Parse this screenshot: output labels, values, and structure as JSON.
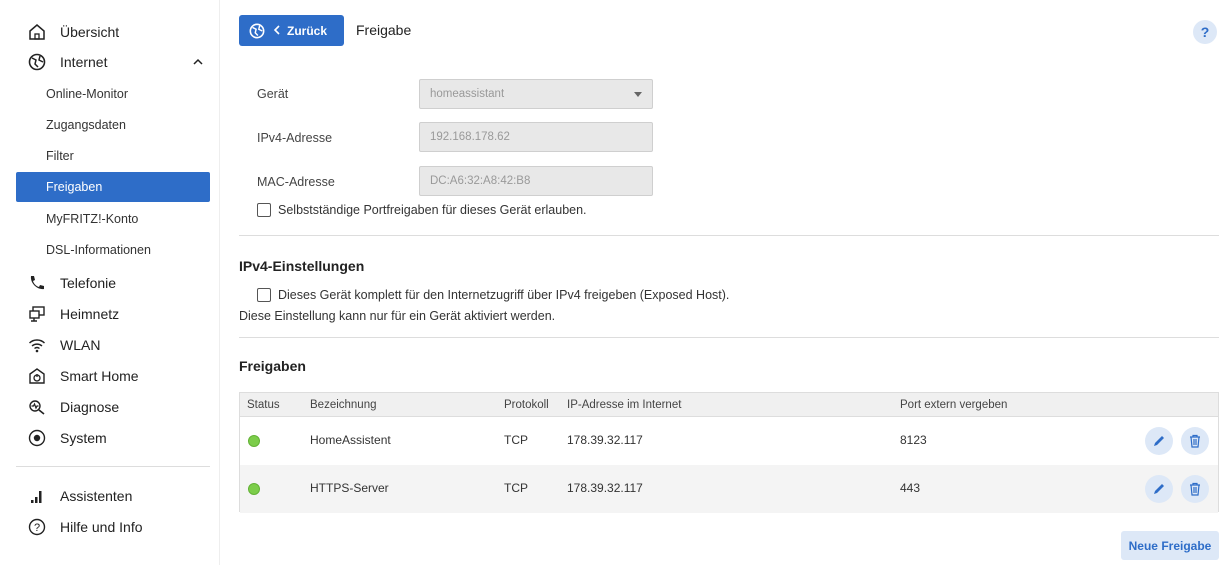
{
  "sidebar": {
    "items": [
      {
        "label": "Übersicht",
        "icon": "home-icon"
      },
      {
        "label": "Internet",
        "icon": "globe-icon"
      },
      {
        "label": "Telefonie",
        "icon": "phone-icon"
      },
      {
        "label": "Heimnetz",
        "icon": "network-icon"
      },
      {
        "label": "WLAN",
        "icon": "wifi-icon"
      },
      {
        "label": "Smart Home",
        "icon": "smarthome-icon"
      },
      {
        "label": "Diagnose",
        "icon": "diagnose-icon"
      },
      {
        "label": "System",
        "icon": "system-icon"
      }
    ],
    "sub_items": [
      {
        "label": "Online-Monitor"
      },
      {
        "label": "Zugangsdaten"
      },
      {
        "label": "Filter"
      },
      {
        "label": "Freigaben",
        "active": true
      },
      {
        "label": "MyFRITZ!-Konto"
      },
      {
        "label": "DSL-Informationen"
      }
    ],
    "bottom_items": [
      {
        "label": "Assistenten",
        "icon": "assistant-icon"
      },
      {
        "label": "Hilfe und Info",
        "icon": "help-circle-icon"
      }
    ]
  },
  "header": {
    "back_label": "Zurück",
    "title": "Freigabe",
    "help": "?"
  },
  "form": {
    "device_label": "Gerät",
    "device_value": "homeassistant",
    "ipv4_label": "IPv4-Adresse",
    "ipv4_value": "192.168.178.62",
    "mac_label": "MAC-Adresse",
    "mac_value": "DC:A6:32:A8:42:B8",
    "self_portforward_label": "Selbstständige Portfreigaben für dieses Gerät erlauben."
  },
  "ipv4_settings": {
    "title": "IPv4-Einstellungen",
    "exposed_host_label": "Dieses Gerät komplett für den Internetzugriff über IPv4 freigeben (Exposed Host).",
    "note": "Diese Einstellung kann nur für ein Gerät aktiviert werden."
  },
  "shares": {
    "title": "Freigaben",
    "columns": [
      "Status",
      "Bezeichnung",
      "Protokoll",
      "IP-Adresse im Internet",
      "Port extern vergeben"
    ],
    "rows": [
      {
        "name": "HomeAssistent",
        "protocol": "TCP",
        "ip": "178.39.32.117",
        "port": "8123",
        "status": "online"
      },
      {
        "name": "HTTPS-Server",
        "protocol": "TCP",
        "ip": "178.39.32.117",
        "port": "443",
        "status": "online"
      }
    ],
    "new_button": "Neue Freigabe"
  },
  "colors": {
    "accent": "#2e6dc8",
    "status_online": "#7ccd4a",
    "button_light": "#dde8f7"
  }
}
